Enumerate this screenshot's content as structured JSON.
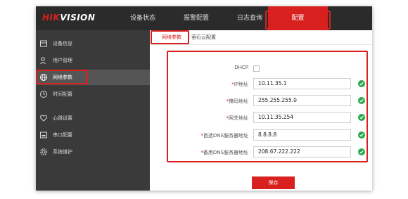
{
  "brand": {
    "logo_text": "HIKVISION"
  },
  "nav": {
    "items": [
      {
        "label": "设备状态"
      },
      {
        "label": "报警配置"
      },
      {
        "label": "日志查询"
      },
      {
        "label": "配置"
      }
    ]
  },
  "sidebar": {
    "items": [
      {
        "label": "设备信息",
        "icon": "device-info-icon"
      },
      {
        "label": "用户管理",
        "icon": "user-icon"
      },
      {
        "label": "网络参数",
        "icon": "globe-icon"
      },
      {
        "label": "时间配置",
        "icon": "clock-icon"
      },
      {
        "label": "心跳设置",
        "icon": "heart-icon"
      },
      {
        "label": "串口配置",
        "icon": "serial-port-icon"
      },
      {
        "label": "系统维护",
        "icon": "gear-icon"
      }
    ]
  },
  "tabs": [
    {
      "label": "网络参数"
    },
    {
      "label": "萤石云配置"
    }
  ],
  "form": {
    "dhcp_label": "DHCP",
    "required_mark": "*",
    "fields": [
      {
        "label": "IP地址",
        "value": "10.11.35.1"
      },
      {
        "label": "掩码地址",
        "value": "255.255.255.0"
      },
      {
        "label": "网关地址",
        "value": "10.11.35.254"
      },
      {
        "label": "首选DNS服务器地址",
        "value": "8.8.8.8"
      },
      {
        "label": "备用DNS服务器地址",
        "value": "208.67.222.222"
      }
    ],
    "save_label": "保存"
  },
  "colors": {
    "accent": "#d8201f",
    "topbar": "#2b2b2b",
    "sidebar": "#3a3a3a",
    "valid": "#27a84a"
  }
}
